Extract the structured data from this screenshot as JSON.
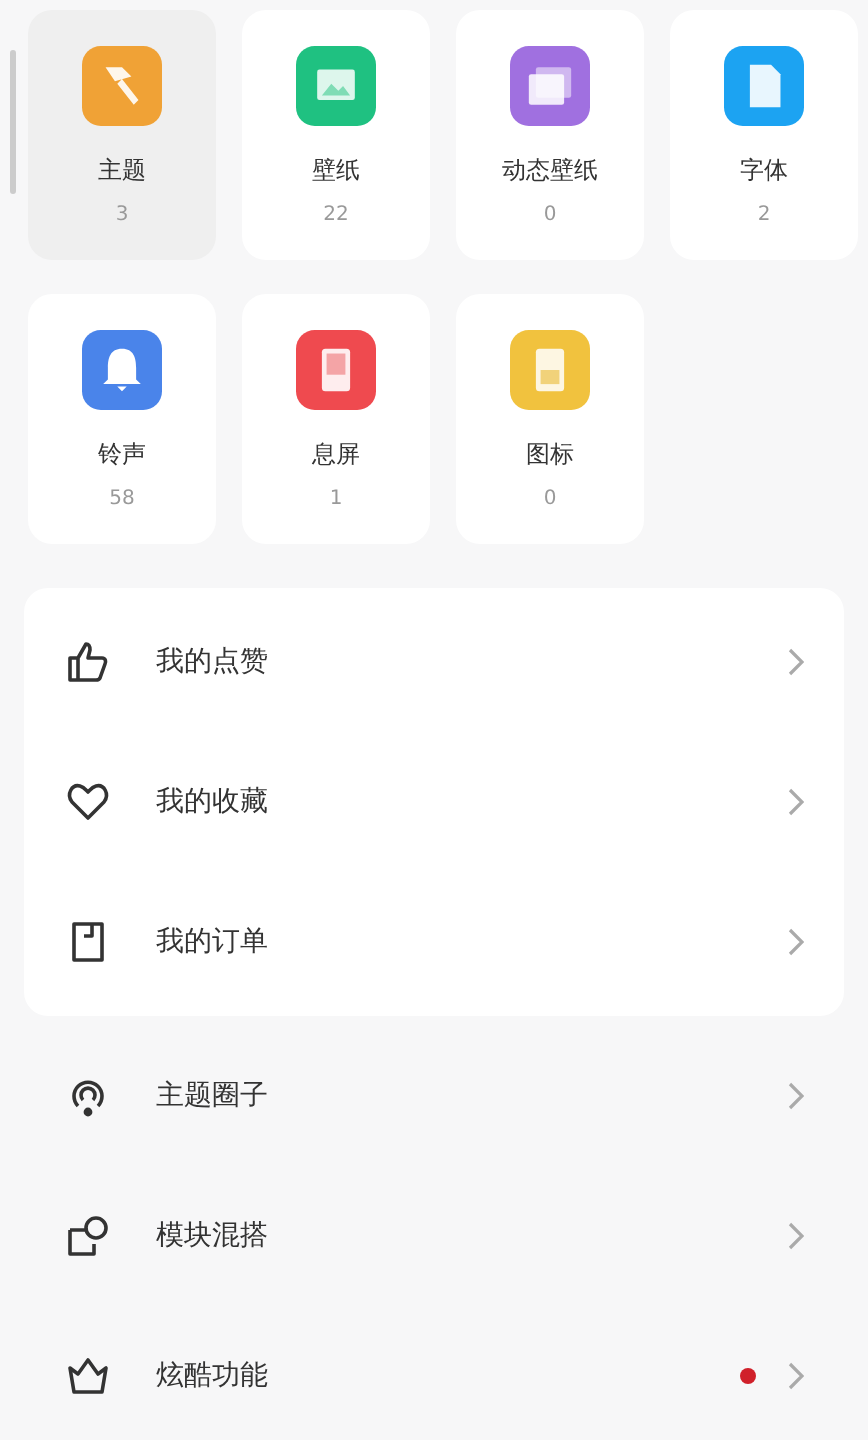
{
  "categories": [
    {
      "label": "主题",
      "count": "3",
      "kind": "brush",
      "color": "#f0a236",
      "selected": true
    },
    {
      "label": "壁纸",
      "count": "22",
      "kind": "image",
      "color": "#1fc181",
      "selected": false
    },
    {
      "label": "动态壁纸",
      "count": "0",
      "kind": "layers",
      "color": "#a070e0",
      "selected": false
    },
    {
      "label": "字体",
      "count": "2",
      "kind": "font",
      "color": "#1ca3f2",
      "selected": false
    },
    {
      "label": "铃声",
      "count": "58",
      "kind": "bell",
      "color": "#4a84ea",
      "selected": false
    },
    {
      "label": "息屏",
      "count": "1",
      "kind": "phone",
      "color": "#ef4a4f",
      "selected": false
    },
    {
      "label": "图标",
      "count": "0",
      "kind": "grid",
      "color": "#f1c23e",
      "selected": false
    }
  ],
  "my_list": [
    {
      "label": "我的点赞",
      "kind": "thumb"
    },
    {
      "label": "我的收藏",
      "kind": "heart"
    },
    {
      "label": "我的订单",
      "kind": "order"
    }
  ],
  "more_list": [
    {
      "label": "主题圈子",
      "kind": "circle",
      "badge": false
    },
    {
      "label": "模块混搭",
      "kind": "mix",
      "badge": false
    },
    {
      "label": "炫酷功能",
      "kind": "crown",
      "badge": true
    }
  ]
}
